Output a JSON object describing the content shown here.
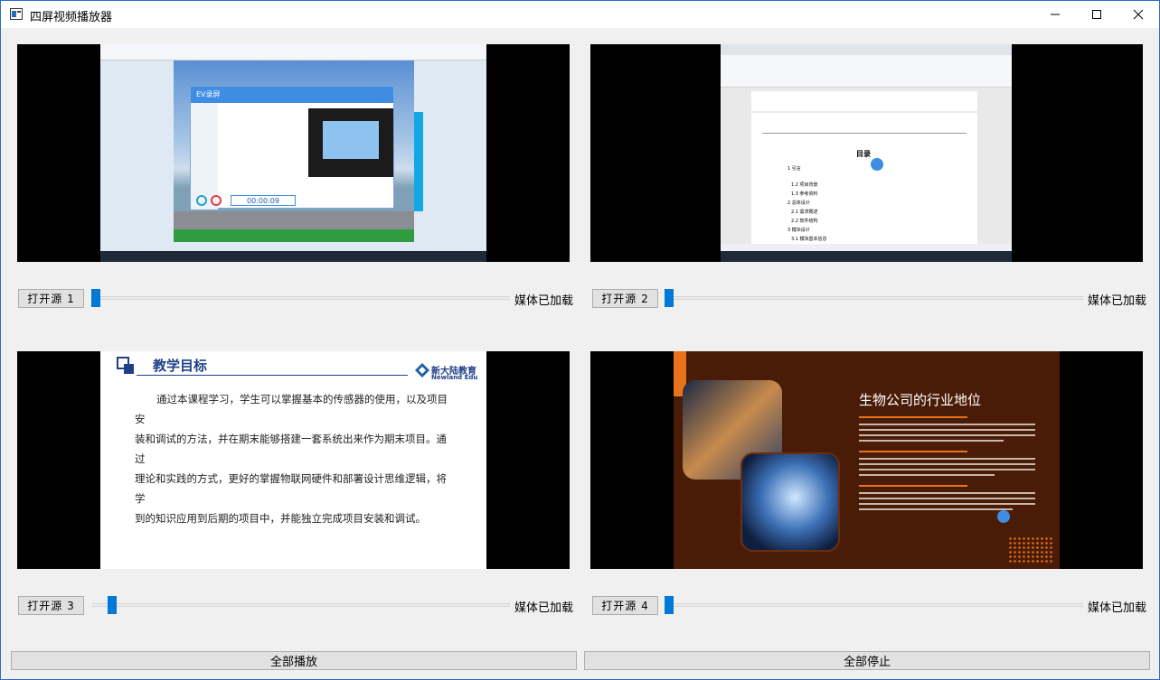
{
  "window": {
    "title": "四屏视频播放器"
  },
  "panels": [
    {
      "open_label": "打开源 1",
      "status": "媒体已加载",
      "progress": 0.0
    },
    {
      "open_label": "打开源 2",
      "status": "媒体已加载",
      "progress": 0.0
    },
    {
      "open_label": "打开源 3",
      "status": "媒体已加载",
      "progress": 0.02
    },
    {
      "open_label": "打开源 4",
      "status": "媒体已加载",
      "progress": 0.0
    }
  ],
  "footer": {
    "play_all": "全部播放",
    "stop_all": "全部停止"
  },
  "video1": {
    "app_title": "EV录屏",
    "timer": "00:00:09"
  },
  "video2": {
    "doc_heading": "目录",
    "toc": [
      "1 引言",
      "1.1 项目背景",
      "1.2 项目背景",
      "1.3 参考资料",
      "2 总体设计",
      "2.1 需求概述",
      "2.2 软件结构",
      "3 模块设计",
      "3.1 模块基本信息"
    ]
  },
  "video3": {
    "slide_title": "教学目标",
    "brand_cn": "新大陆教育",
    "brand_en": "Newland Edu",
    "body": "通过本课程学习，学生可以掌握基本的传感器的使用，以及项目安装和调试的方法，并在期末能够搭建一套系统出来作为期末项目。通过理论和实践的方式，更好的掌握物联网硬件和部署设计思维逻辑，将学到的知识应用到后期的项目中，并能独立完成项目安装和调试。",
    "body_lines": [
      "通过本课程学习，学生可以掌握基本的传感器的使用，以及项目安",
      "装和调试的方法，并在期末能够搭建一套系统出来作为期末项目。通过",
      "理论和实践的方式，更好的掌握物联网硬件和部署设计思维逻辑，将学",
      "到的知识应用到后期的项目中，并能独立完成项目安装和调试。"
    ]
  },
  "video4": {
    "slide_title": "生物公司的行业地位"
  },
  "colors": {
    "accent": "#0078d7",
    "slide4_bg": "#4a1c08",
    "slide3_title": "#1f3f86"
  }
}
